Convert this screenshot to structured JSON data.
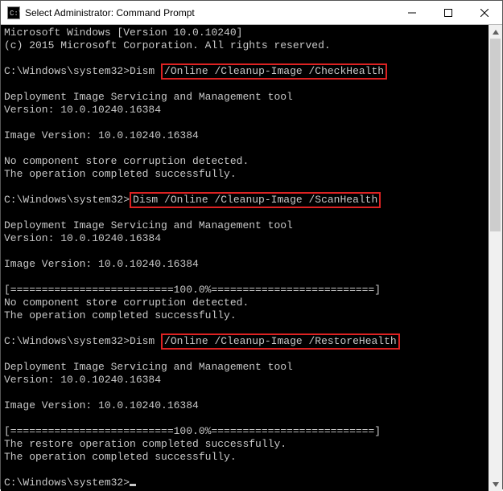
{
  "titlebar": {
    "icon_name": "cmd-icon",
    "title": "Select Administrator: Command Prompt"
  },
  "window_controls": {
    "minimize": "minimize-button",
    "maximize": "maximize-button",
    "close": "close-button"
  },
  "terminal": {
    "line1": "Microsoft Windows [Version 10.0.10240]",
    "line2": "(c) 2015 Microsoft Corporation. All rights reserved.",
    "blank": "",
    "prompt_cmd1_pre": "C:\\Windows\\system32>Dism ",
    "prompt_cmd1_hl": "/Online /Cleanup-Image /CheckHealth",
    "tool_header": "Deployment Image Servicing and Management tool",
    "tool_version": "Version: 10.0.10240.16384",
    "img_version": "Image Version: 10.0.10240.16384",
    "no_corruption": "No component store corruption detected.",
    "op_success": "The operation completed successfully.",
    "prompt_cmd2_pre": "C:\\Windows\\system32>",
    "prompt_cmd2_hl": "Dism /Online /Cleanup-Image /ScanHealth",
    "progress": "[==========================100.0%==========================]",
    "prompt_cmd3_pre": "C:\\Windows\\system32>Dism ",
    "prompt_cmd3_hl": "/Online /Cleanup-Image /RestoreHealth",
    "restore_success": "The restore operation completed successfully.",
    "prompt_empty": "C:\\Windows\\system32>"
  }
}
